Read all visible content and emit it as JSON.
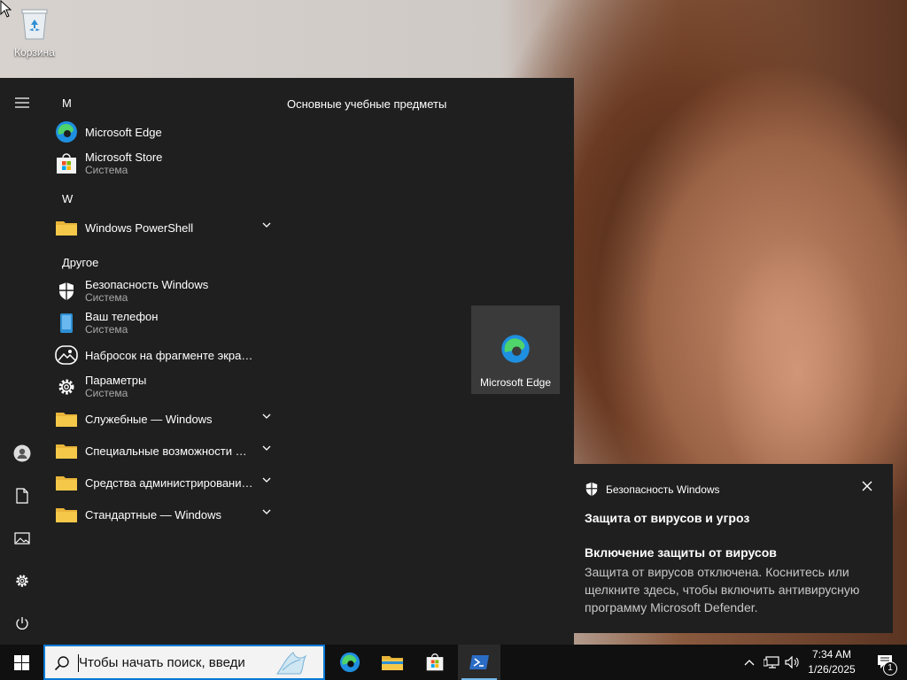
{
  "desktop": {
    "recycle_bin_label": "Корзина"
  },
  "start_menu": {
    "sections": [
      {
        "letter": "M"
      },
      {
        "letter": "W"
      },
      {
        "letter": "Другое"
      }
    ],
    "apps": {
      "edge": {
        "name": "Microsoft Edge",
        "sub": ""
      },
      "store": {
        "name": "Microsoft Store",
        "sub": "Система"
      },
      "powershell": {
        "name": "Windows PowerShell",
        "sub": ""
      },
      "security": {
        "name": "Безопасность Windows",
        "sub": "Система"
      },
      "phone": {
        "name": "Ваш телефон",
        "sub": "Система"
      },
      "snip": {
        "name": "Набросок на фрагменте экрана",
        "sub": ""
      },
      "settings": {
        "name": "Параметры",
        "sub": "Система"
      },
      "service": {
        "name": "Служебные — Windows",
        "sub": ""
      },
      "access": {
        "name": "Специальные возможности Win...",
        "sub": ""
      },
      "admin": {
        "name": "Средства администрирования W...",
        "sub": ""
      },
      "standard": {
        "name": "Стандартные — Windows",
        "sub": ""
      }
    },
    "group_title": "Основные учебные предметы",
    "tile": {
      "label": "Microsoft Edge"
    }
  },
  "toast": {
    "app_name": "Безопасность Windows",
    "title": "Защита от вирусов и угроз",
    "heading": "Включение защиты от вирусов",
    "body": "Защита от вирусов отключена. Коснитесь или щелкните здесь, чтобы включить антивирусную программу Microsoft Defender."
  },
  "taskbar": {
    "search_placeholder": "Чтобы начать поиск, введи",
    "clock_time": "7:34 AM",
    "clock_date": "1/26/2025",
    "notification_count": "1"
  },
  "colors": {
    "accent": "#0078d4",
    "menu_bg": "#1f1f1f",
    "taskbar_bg": "#101010",
    "folder": "#e8b43a"
  }
}
